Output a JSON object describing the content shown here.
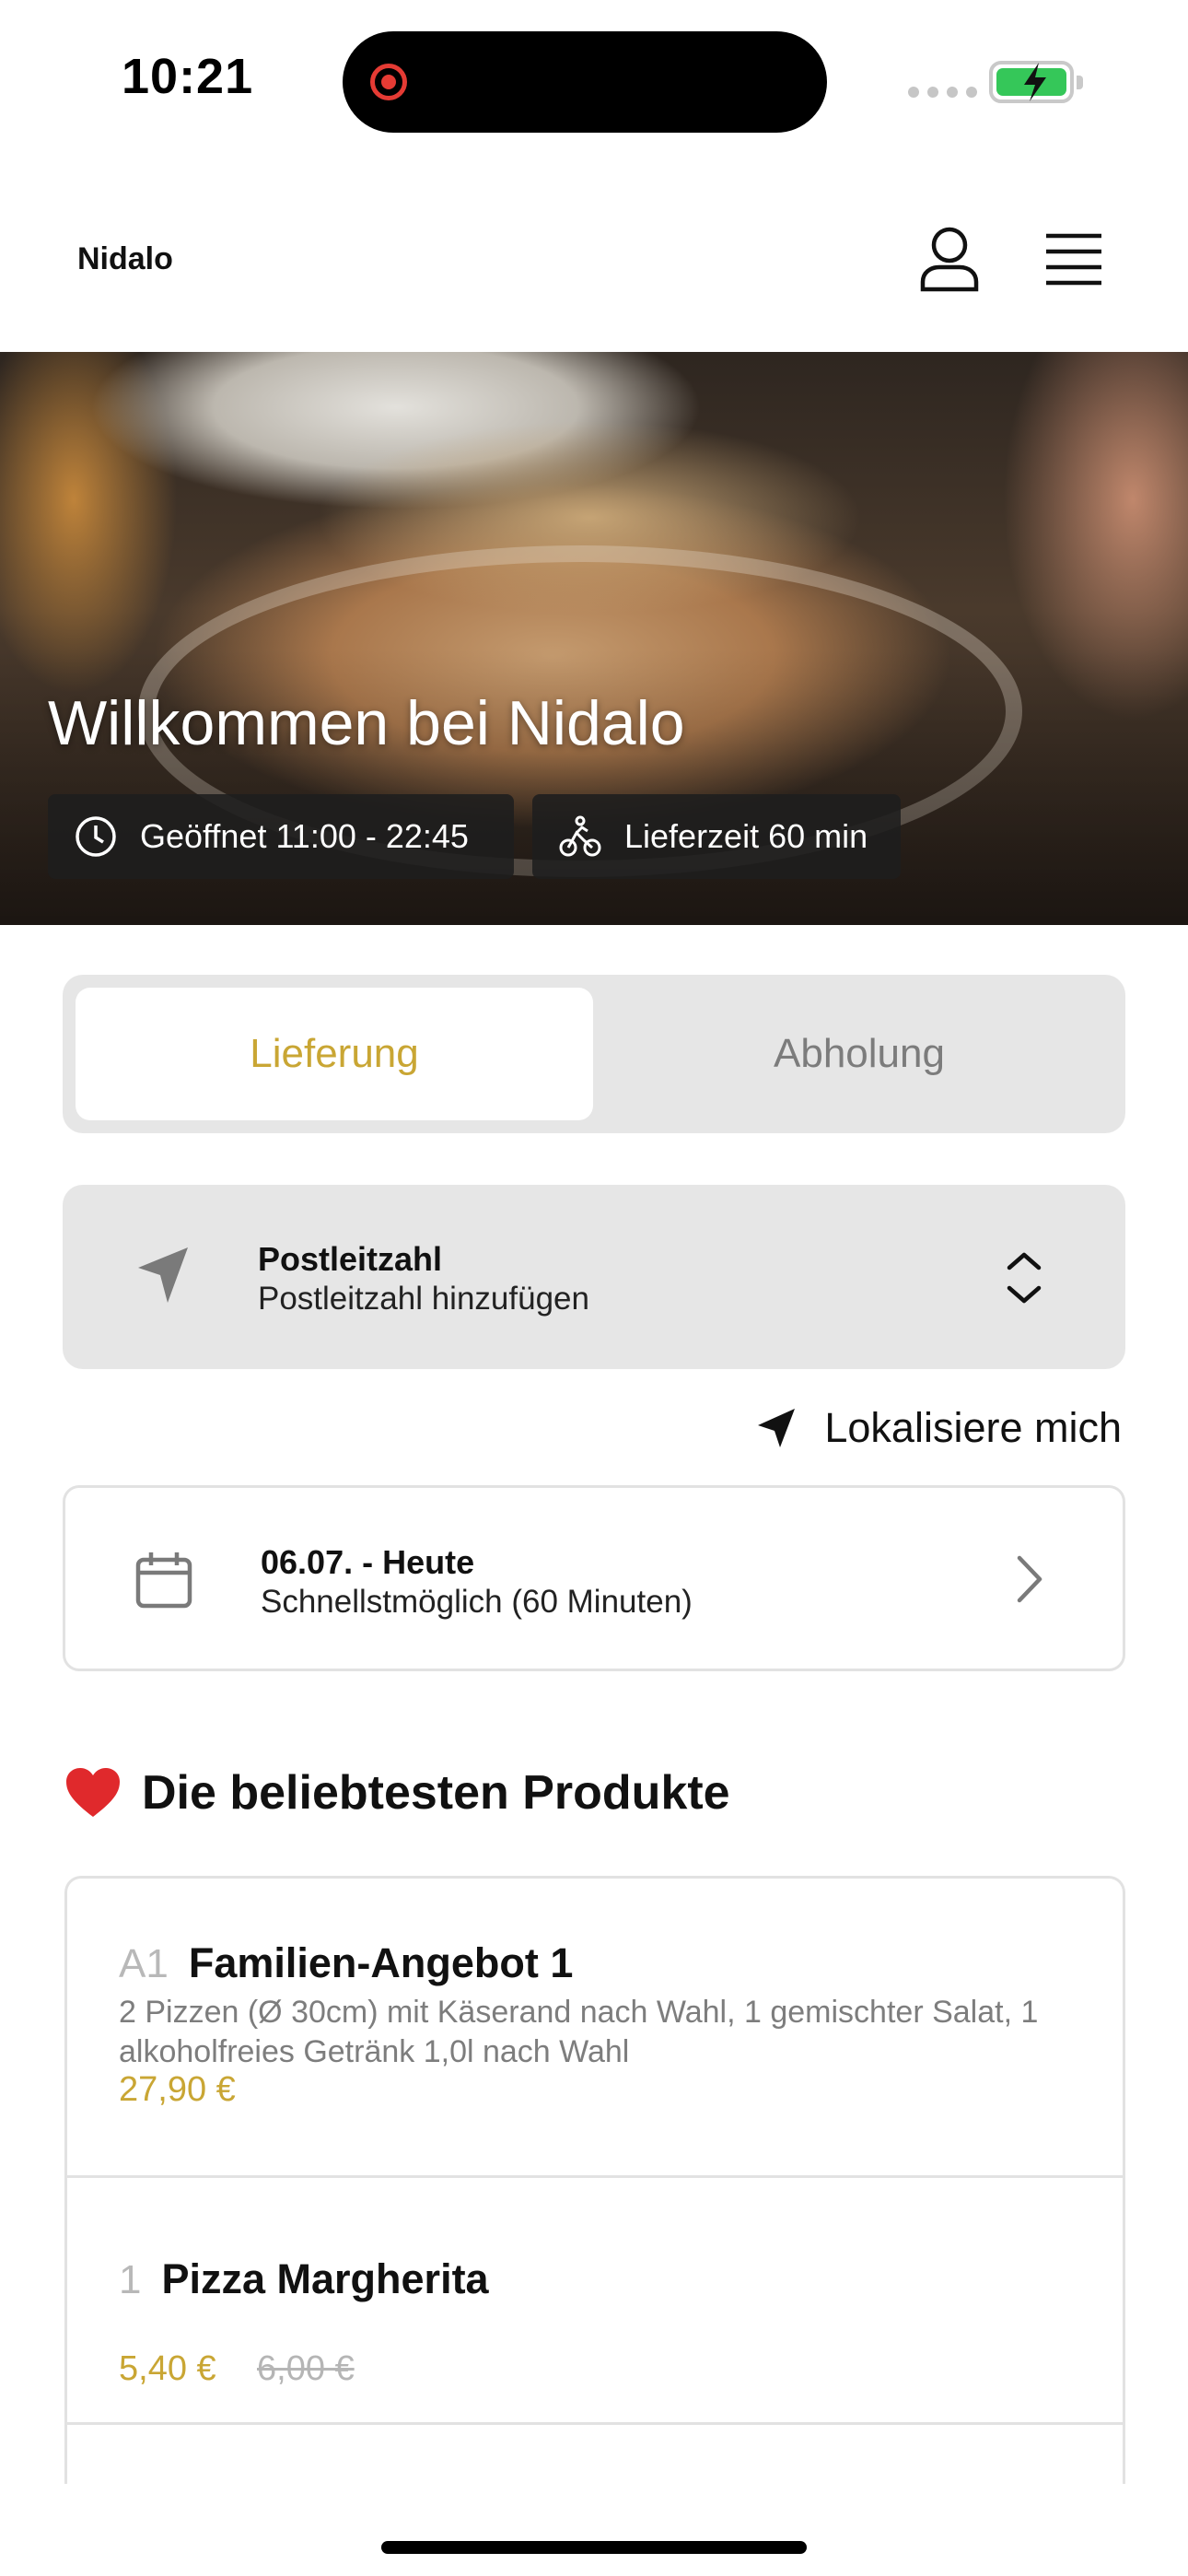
{
  "status_bar": {
    "time": "10:21"
  },
  "header": {
    "brand": "Nidalo"
  },
  "hero": {
    "title": "Willkommen bei Nidalo",
    "opening_hours": "Geöffnet 11:00 - 22:45",
    "delivery_time": "Lieferzeit 60 min"
  },
  "order_mode": {
    "options": [
      "Lieferung",
      "Abholung"
    ],
    "selected": "Lieferung"
  },
  "postal": {
    "label": "Postleitzahl",
    "placeholder": "Postleitzahl hinzufügen"
  },
  "locate": {
    "label": "Lokalisiere mich"
  },
  "schedule": {
    "date": "06.07. - Heute",
    "time": "Schnellstmöglich (60 Minuten)"
  },
  "popular": {
    "title": "Die beliebtesten Produkte",
    "products": [
      {
        "number": "A1",
        "name": "Familien-Angebot 1",
        "description": "2 Pizzen (Ø 30cm) mit Käserand nach Wahl, 1 gemischter Salat, 1 alkoholfreies Getränk 1,0l nach Wahl",
        "price": "27,90 €"
      },
      {
        "number": "1",
        "name": "Pizza Margherita",
        "price": "5,40 €",
        "old_price": "6,00 €"
      }
    ]
  },
  "colors": {
    "accent": "#c9a634",
    "field_bg": "#e6e6e6",
    "battery": "#35c759",
    "heart": "#e0292c"
  },
  "icons": [
    "user-icon",
    "menu-icon",
    "clock-icon",
    "bike-icon",
    "navigation-arrow-icon",
    "chevron-up-down-icon",
    "calendar-icon",
    "chevron-right-icon",
    "heart-icon"
  ]
}
